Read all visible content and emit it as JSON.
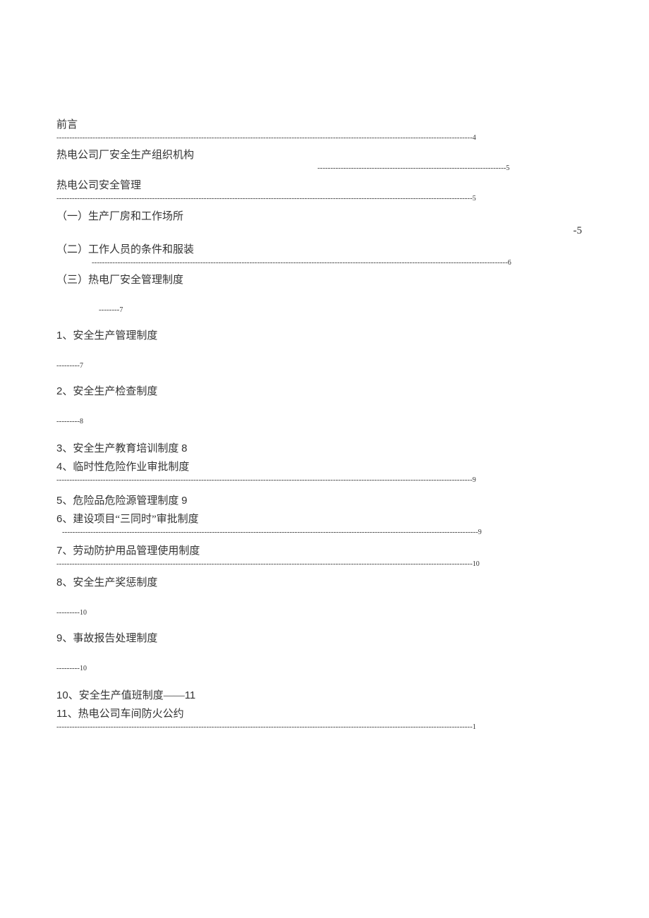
{
  "toc": {
    "e1": {
      "title": "前言",
      "page": "4"
    },
    "e2": {
      "title": "热电公司厂安全生产组织机构",
      "page": "5"
    },
    "e3": {
      "title": "热电公司安全管理",
      "page": "5"
    },
    "e4": {
      "title": "（一）生产厂房和工作场所",
      "page": "-5"
    },
    "e5": {
      "title": "（二）工作人员的条件和服装",
      "page": "6"
    },
    "e6": {
      "title": "（三）热电厂安全管理制度",
      "page": "7"
    },
    "e7": {
      "title": "1、安全生产管理制度",
      "page": "7"
    },
    "e8": {
      "title": "2、安全生产检查制度",
      "page": "8"
    },
    "e9": {
      "title": "3、安全生产教育培训制度 8"
    },
    "e10": {
      "title": "4、临时性危险作业审批制度",
      "page": "9"
    },
    "e11": {
      "title": "5、危险品危险源管理制度 9"
    },
    "e12": {
      "title": "6、建设项目\"三同时\"审批制度",
      "page": "9"
    },
    "e13": {
      "title": "7、劳动防护用品管理使用制度",
      "page": "10"
    },
    "e14": {
      "title": "8、安全生产奖惩制度",
      "page": "10"
    },
    "e15": {
      "title": "9、事故报告处理制度",
      "page": "10"
    },
    "e16": {
      "title": "10、安全生产值班制度——11"
    },
    "e17": {
      "title": "11、热电公司车间防火公约",
      "page": "1"
    }
  },
  "leaders": {
    "full": "-----------------------------------------------------------------------------------------------------------------------------------------------------------------",
    "half": "-------------------------------------------------------------------------",
    "short8": "--------",
    "short9": "---------"
  }
}
